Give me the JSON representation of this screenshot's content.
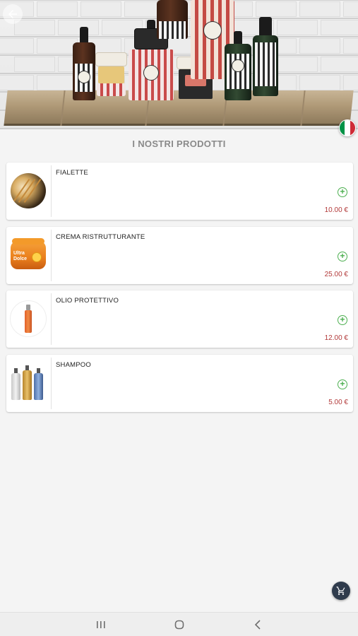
{
  "header": {
    "back_icon": "arrow-left-icon",
    "language_flag": "italy-flag-icon",
    "flag_colors": [
      "#009246",
      "#ffffff",
      "#ce2b37"
    ]
  },
  "section": {
    "title": "I NOSTRI PRODOTTI"
  },
  "products": [
    {
      "name": "FIALETTE",
      "price": "10.00 €",
      "thumb": "hair-vials-image",
      "add_icon": "plus-circle-icon"
    },
    {
      "name": "CREMA RISTRUTTURANTE",
      "price": "25.00 €",
      "thumb": "cream-jar-image",
      "add_icon": "plus-circle-icon"
    },
    {
      "name": "OLIO PROTETTIVO",
      "price": "12.00 €",
      "thumb": "oil-spray-image",
      "add_icon": "plus-circle-icon"
    },
    {
      "name": "SHAMPOO",
      "price": "5.00 €",
      "thumb": "shampoo-bottles-image",
      "add_icon": "plus-circle-icon"
    }
  ],
  "jar_brand_text": "Ultra Dolce",
  "cart_fab": {
    "icon": "cart-icon"
  },
  "navbar": {
    "recents_icon": "recents-icon",
    "home_icon": "home-icon",
    "back_icon": "nav-back-icon"
  },
  "colors": {
    "add_green": "#4caf50",
    "price_red": "#b23a3a",
    "fab_bg": "#2f3b4c",
    "background": "#f4f4f4"
  }
}
